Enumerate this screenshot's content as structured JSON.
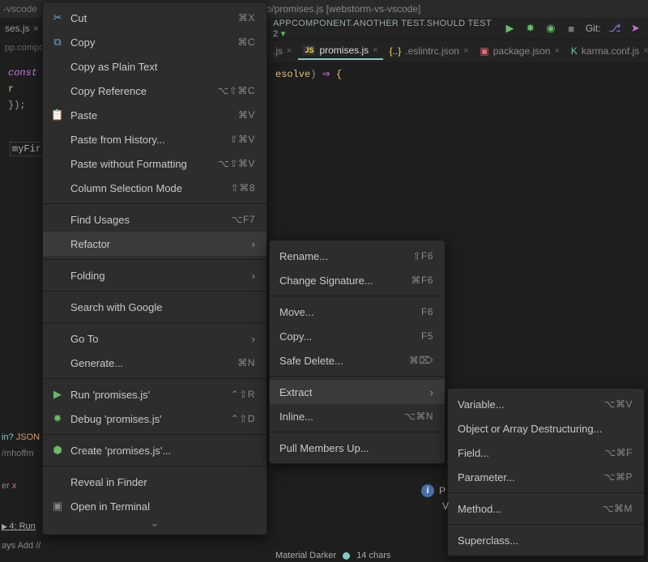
{
  "title": {
    "prefix": "-vscode",
    "center": "criptDemo/promises.js [webstorm-vs-vscode]"
  },
  "left_tab": {
    "label": "ses.js"
  },
  "breadcrumb": "pp.compone",
  "run_config": "APPCOMPONENT.ANOTHER TEST.SHOULD TEST 2",
  "git_label": "Git:",
  "tabs": [
    {
      "label": ".js",
      "icon": "js",
      "active": false
    },
    {
      "label": "promises.js",
      "icon": "js",
      "active": true
    },
    {
      "label": ".eslintrc.json",
      "icon": "json",
      "active": false
    },
    {
      "label": "package.json",
      "icon": "json-red",
      "active": false
    },
    {
      "label": "karma.conf.js",
      "icon": "karma",
      "active": false
    }
  ],
  "code": {
    "line1_const": "const",
    "line2_indent": "    r",
    "line3": "});",
    "myfirst": "myFir",
    "resolve": "esolve",
    "arrow": "⇒",
    "brace": "{",
    "paren": ")"
  },
  "menu1": [
    {
      "icon": "cut",
      "label": "Cut",
      "shortcut": "⌘X"
    },
    {
      "icon": "copy",
      "label": "Copy",
      "shortcut": "⌘C"
    },
    {
      "icon": "",
      "label": "Copy as Plain Text",
      "shortcut": ""
    },
    {
      "icon": "",
      "label": "Copy Reference",
      "shortcut": "⌥⇧⌘C"
    },
    {
      "icon": "paste",
      "label": "Paste",
      "shortcut": "⌘V"
    },
    {
      "icon": "",
      "label": "Paste from History...",
      "shortcut": "⇧⌘V"
    },
    {
      "icon": "",
      "label": "Paste without Formatting",
      "shortcut": "⌥⇧⌘V"
    },
    {
      "icon": "",
      "label": "Column Selection Mode",
      "shortcut": "⇧⌘8"
    },
    {
      "sep": true
    },
    {
      "icon": "",
      "label": "Find Usages",
      "shortcut": "⌥F7"
    },
    {
      "icon": "",
      "label": "Refactor",
      "submenu": true,
      "highlighted": true
    },
    {
      "sep": true
    },
    {
      "icon": "",
      "label": "Folding",
      "submenu": true
    },
    {
      "sep": true
    },
    {
      "icon": "",
      "label": "Search with Google",
      "shortcut": ""
    },
    {
      "sep": true
    },
    {
      "icon": "",
      "label": "Go To",
      "submenu": true
    },
    {
      "icon": "",
      "label": "Generate...",
      "shortcut": "⌘N"
    },
    {
      "sep": true
    },
    {
      "icon": "run",
      "label": "Run 'promises.js'",
      "shortcut": "⌃⇧R"
    },
    {
      "icon": "debug",
      "label": "Debug 'promises.js'",
      "shortcut": "⌃⇧D"
    },
    {
      "sep": true
    },
    {
      "icon": "node",
      "label": "Create 'promises.js'...",
      "shortcut": ""
    },
    {
      "sep": true
    },
    {
      "icon": "",
      "label": "Reveal in Finder",
      "shortcut": ""
    },
    {
      "icon": "term",
      "label": "Open in Terminal",
      "shortcut": ""
    }
  ],
  "menu2": [
    {
      "label": "Rename...",
      "shortcut": "⇧F6"
    },
    {
      "label": "Change Signature...",
      "shortcut": "⌘F6"
    },
    {
      "sep": true
    },
    {
      "label": "Move...",
      "shortcut": "F6"
    },
    {
      "label": "Copy...",
      "shortcut": "F5"
    },
    {
      "label": "Safe Delete...",
      "shortcut": "⌘⌦"
    },
    {
      "sep": true
    },
    {
      "label": "Extract",
      "submenu": true,
      "highlighted": true
    },
    {
      "label": "Inline...",
      "shortcut": "⌥⌘N"
    },
    {
      "sep": true
    },
    {
      "label": "Pull Members Up...",
      "shortcut": ""
    }
  ],
  "menu3": [
    {
      "label": "Variable...",
      "shortcut": "⌥⌘V"
    },
    {
      "label": "Object or Array Destructuring...",
      "shortcut": ""
    },
    {
      "label": "Field...",
      "shortcut": "⌥⌘F"
    },
    {
      "label": "Parameter...",
      "shortcut": "⌥⌘P"
    },
    {
      "sep": true
    },
    {
      "label": "Method...",
      "shortcut": "⌥⌘M"
    },
    {
      "sep": true
    },
    {
      "label": "Superclass...",
      "shortcut": ""
    }
  ],
  "bottom": {
    "in": "in?",
    "json": "JSON",
    "path": "/mhoffm",
    "err_prefix": "er",
    "err_x": "x",
    "run": "4: Run",
    "add": "ays Add //"
  },
  "pill_p": "P",
  "pill_v": "V",
  "status": {
    "theme": "Material Darker",
    "chars": "14 chars"
  }
}
